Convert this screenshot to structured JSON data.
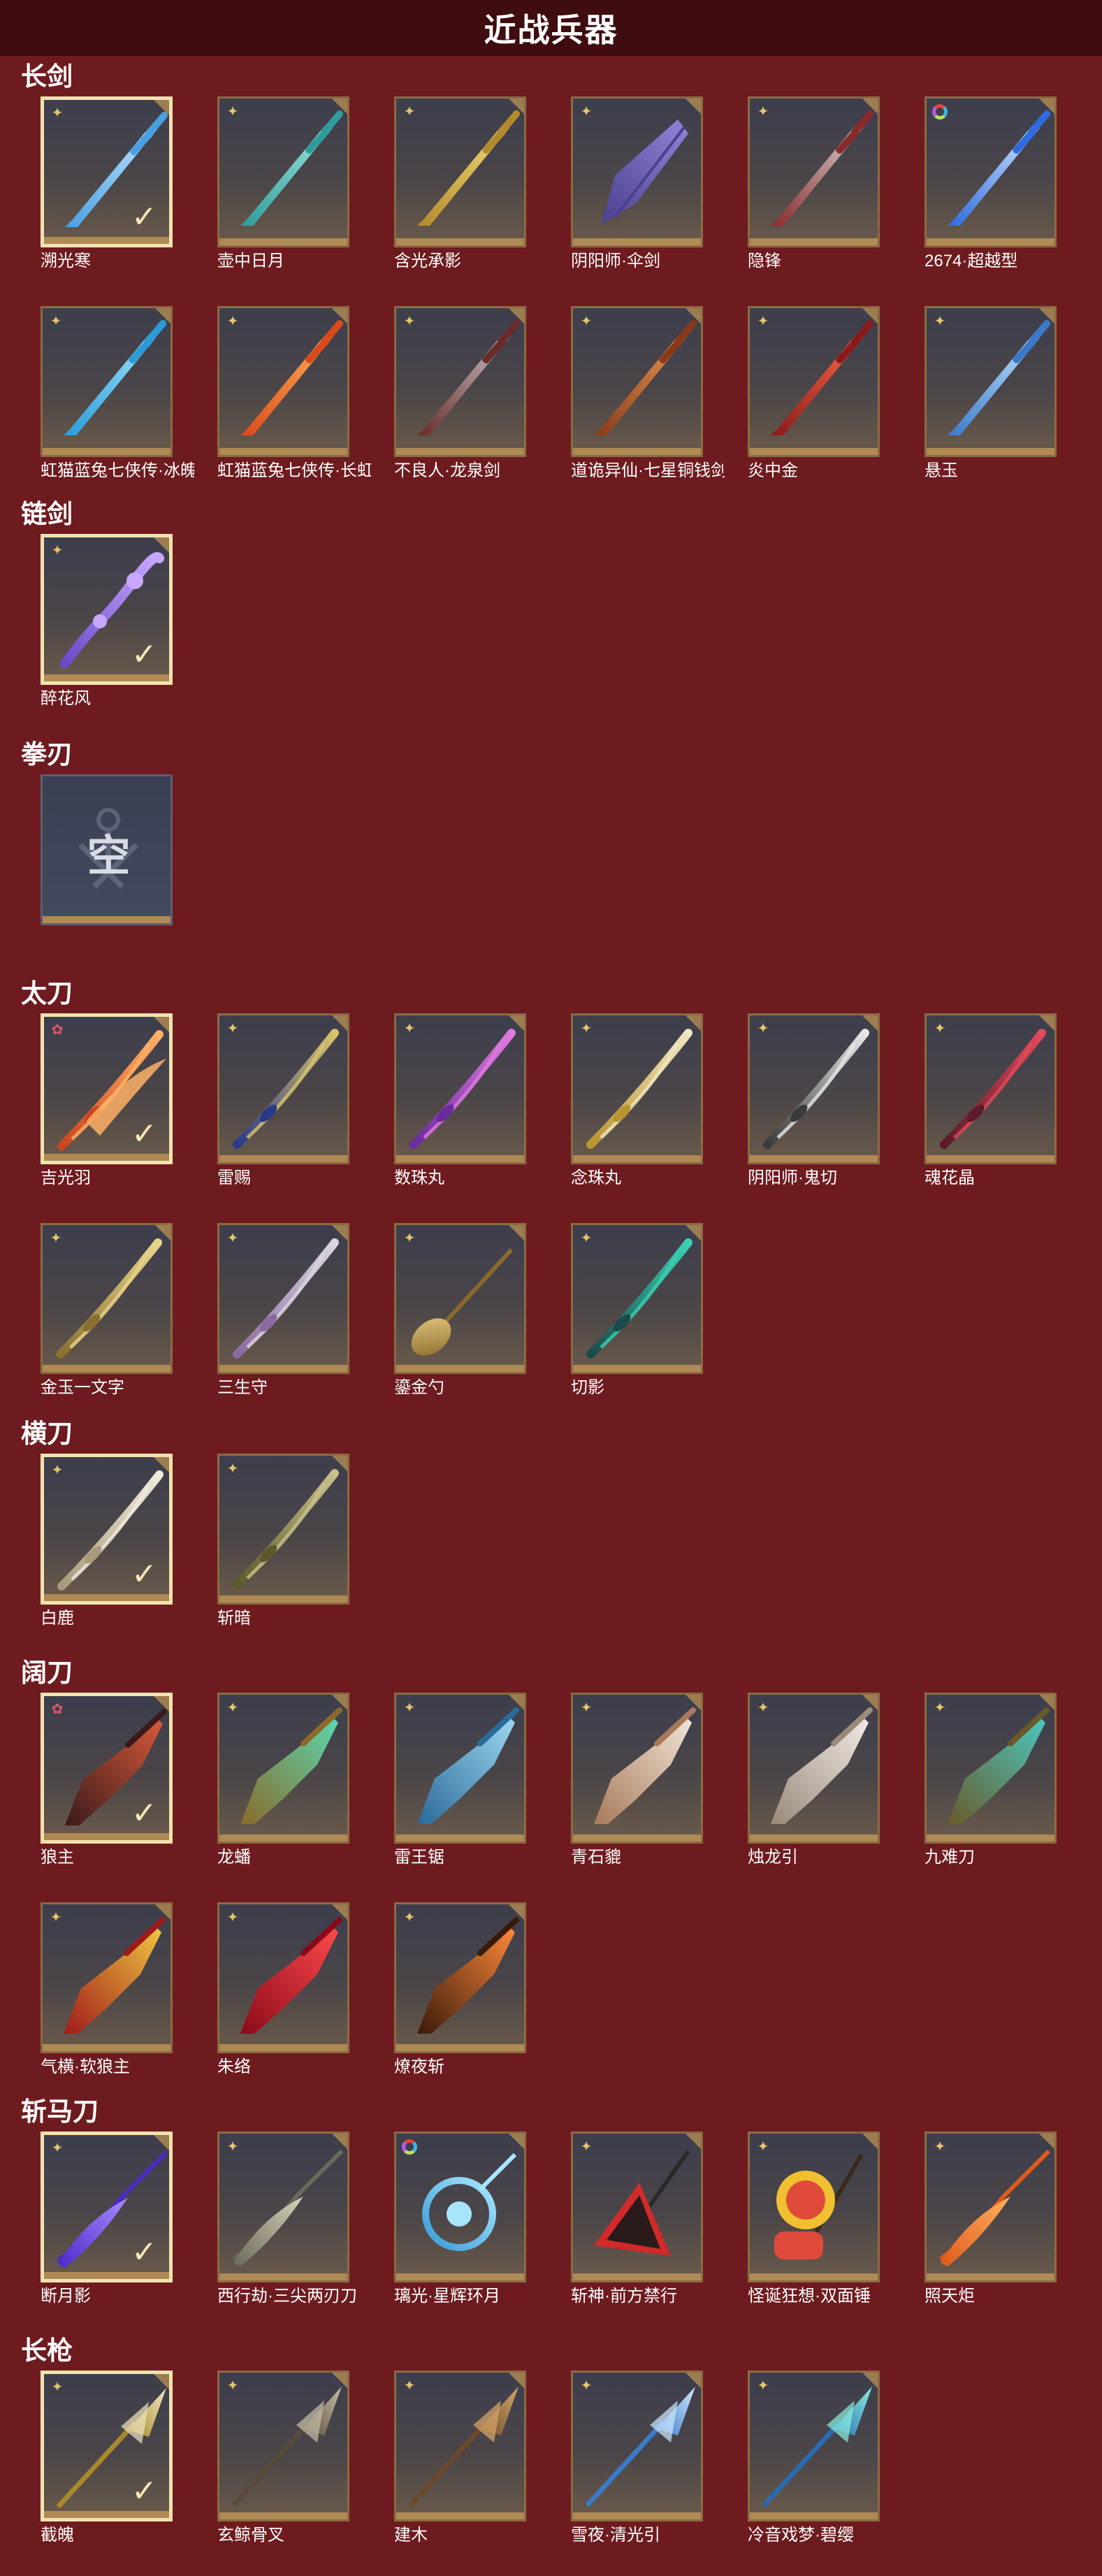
{
  "header": {
    "title": "近战兵器"
  },
  "sections": [
    {
      "label": "长剑",
      "items": [
        {
          "name": "溯光寒",
          "badge": "star4",
          "selected": true,
          "weapon": "sword",
          "c1": "#bfe6ff",
          "c2": "#4a9fe0"
        },
        {
          "name": "壶中日月",
          "badge": "star4",
          "weapon": "sword",
          "c1": "#9fe8e0",
          "c2": "#2f9b9b"
        },
        {
          "name": "含光承影",
          "badge": "star4",
          "weapon": "sword",
          "c1": "#f2df7a",
          "c2": "#b38a2c"
        },
        {
          "name": "阴阳师·伞剑",
          "badge": "star4",
          "weapon": "umbrella",
          "c1": "#8f86d8",
          "c2": "#4b3f8e"
        },
        {
          "name": "隐锋",
          "badge": "star4",
          "weapon": "sword",
          "c1": "#d7d7d7",
          "c2": "#8a2a2a"
        },
        {
          "name": "2674·超越型",
          "badge": "ring",
          "weapon": "sword",
          "c1": "#d7ecff",
          "c2": "#2f6ae0"
        },
        {
          "name": "虹猫蓝兔七侠传·冰魄...",
          "badge": "star4",
          "weapon": "sword",
          "c1": "#9fe6ff",
          "c2": "#2b9bd8"
        },
        {
          "name": "虹猫蓝兔七侠传·长虹...",
          "badge": "star4",
          "weapon": "sword",
          "c1": "#ffb25a",
          "c2": "#d94a1a"
        },
        {
          "name": "不良人·龙泉剑",
          "badge": "star4",
          "weapon": "sword",
          "c1": "#c9c9c9",
          "c2": "#6a2a2a"
        },
        {
          "name": "道诡异仙·七星铜钱剑",
          "badge": "star4",
          "weapon": "sword",
          "c1": "#e89a55",
          "c2": "#8a3a1a"
        },
        {
          "name": "炎中金",
          "badge": "star4",
          "weapon": "sword",
          "c1": "#ff6a4a",
          "c2": "#8a1a1a"
        },
        {
          "name": "悬玉",
          "badge": "star4",
          "weapon": "sword",
          "c1": "#c7e4ff",
          "c2": "#3a7ac8"
        }
      ]
    },
    {
      "label": "链剑",
      "items": [
        {
          "name": "醉花风",
          "badge": "star4",
          "selected": true,
          "weapon": "chain",
          "c1": "#c8a8ff",
          "c2": "#6a4ac8"
        }
      ]
    },
    {
      "label": "拳刃",
      "items": [
        {
          "name": "",
          "badge": "none",
          "empty": true,
          "empty_text": "空"
        }
      ]
    },
    {
      "label": "太刀",
      "items": [
        {
          "name": "吉光羽",
          "badge": "star6",
          "selected": true,
          "weapon": "wing",
          "c1": "#ffb067",
          "c2": "#c8461e"
        },
        {
          "name": "雷赐",
          "badge": "star4",
          "weapon": "katana",
          "c1": "#d8c36a",
          "c2": "#2a3a8a"
        },
        {
          "name": "数珠丸",
          "badge": "star4",
          "weapon": "katana",
          "c1": "#e07adf",
          "c2": "#6a2aa0"
        },
        {
          "name": "念珠丸",
          "badge": "star4",
          "weapon": "katana",
          "c1": "#f0e6c0",
          "c2": "#b8942e"
        },
        {
          "name": "阴阳师·鬼切",
          "badge": "star4",
          "weapon": "katana",
          "c1": "#e6e6e6",
          "c2": "#3a3a3a"
        },
        {
          "name": "魂花晶",
          "badge": "star4",
          "weapon": "katana",
          "c1": "#e04a5a",
          "c2": "#5a1a2a"
        },
        {
          "name": "金玉一文字",
          "badge": "star4",
          "weapon": "katana",
          "c1": "#e8d58a",
          "c2": "#8a7030"
        },
        {
          "name": "三生守",
          "badge": "star4",
          "weapon": "katana",
          "c1": "#dcd6e0",
          "c2": "#8a6aa0"
        },
        {
          "name": "鎏金勺",
          "badge": "star4",
          "weapon": "spoon",
          "c1": "#e6c880",
          "c2": "#8a6a2a"
        },
        {
          "name": "切影",
          "badge": "star4",
          "weapon": "katana",
          "c1": "#3ad0b0",
          "c2": "#1a4a4a"
        }
      ]
    },
    {
      "label": "横刀",
      "items": [
        {
          "name": "白鹿",
          "badge": "star4",
          "selected": true,
          "weapon": "katana",
          "c1": "#f0eadc",
          "c2": "#a89a7a"
        },
        {
          "name": "斩暗",
          "badge": "star4",
          "weapon": "katana",
          "c1": "#c8c08a",
          "c2": "#5a5a2a"
        }
      ]
    },
    {
      "label": "阔刀",
      "items": [
        {
          "name": "狼主",
          "badge": "star6",
          "selected": true,
          "weapon": "broad",
          "c1": "#d85a3a",
          "c2": "#3a1a1a"
        },
        {
          "name": "龙蟠",
          "badge": "star4",
          "weapon": "broad",
          "c1": "#5ad8b0",
          "c2": "#8a6a2a"
        },
        {
          "name": "雷王锯",
          "badge": "star4",
          "weapon": "broad",
          "c1": "#9fd8f0",
          "c2": "#2a6a9a"
        },
        {
          "name": "青石貔",
          "badge": "star4",
          "weapon": "broad",
          "c1": "#f0e6d8",
          "c2": "#a87a5a"
        },
        {
          "name": "烛龙引",
          "badge": "star4",
          "weapon": "broad",
          "c1": "#f0ece6",
          "c2": "#9a8a7a"
        },
        {
          "name": "九难刀",
          "badge": "star4",
          "weapon": "broad",
          "c1": "#4ac8c0",
          "c2": "#6a5a2a"
        },
        {
          "name": "气横·软狼主",
          "badge": "star4",
          "weapon": "broad",
          "c1": "#f0c840",
          "c2": "#a01a1a"
        },
        {
          "name": "朱络",
          "badge": "star4",
          "weapon": "broad",
          "c1": "#ff4a4a",
          "c2": "#8a0a1a"
        },
        {
          "name": "燎夜斩",
          "badge": "star4",
          "weapon": "broad",
          "c1": "#ff8a3a",
          "c2": "#3a1a0a"
        }
      ]
    },
    {
      "label": "斩马刀",
      "items": [
        {
          "name": "断月影",
          "badge": "star4",
          "selected": true,
          "weapon": "glaive",
          "c1": "#a88aff",
          "c2": "#4a2ac8"
        },
        {
          "name": "西行劫·三尖两刃刀",
          "badge": "star4",
          "weapon": "glaive",
          "c1": "#d8d0b8",
          "c2": "#6a6a5a"
        },
        {
          "name": "璃光·星辉环月",
          "badge": "ring",
          "weapon": "ringblade",
          "c1": "#a8e6ff",
          "c2": "#3a9ad8"
        },
        {
          "name": "斩神·前方禁行",
          "badge": "star4",
          "weapon": "sign",
          "c1": "#d02a2a",
          "c2": "#2a1a1a"
        },
        {
          "name": "怪诞狂想·双面锤",
          "badge": "star4",
          "weapon": "hammer",
          "c1": "#e04a3a",
          "c2": "#f0c030"
        },
        {
          "name": "照天炬",
          "badge": "star4",
          "weapon": "glaive",
          "c1": "#ffb060",
          "c2": "#e05a1a"
        }
      ]
    },
    {
      "label": "长枪",
      "items": [
        {
          "name": "截魄",
          "badge": "star4",
          "selected": true,
          "weapon": "spear",
          "c1": "#f0e6c0",
          "c2": "#a8882a"
        },
        {
          "name": "玄鲸骨叉",
          "badge": "star4",
          "weapon": "spear",
          "c1": "#c8c0a8",
          "c2": "#5a4a3a"
        },
        {
          "name": "建木",
          "badge": "star4",
          "weapon": "spear",
          "c1": "#d8a86a",
          "c2": "#6a4a2a"
        },
        {
          "name": "雪夜·清光引",
          "badge": "star4",
          "weapon": "spear",
          "c1": "#cfeaff",
          "c2": "#3a7ac8"
        },
        {
          "name": "冷音戏梦·碧缨",
          "badge": "star4",
          "weapon": "spear",
          "c1": "#8af0e0",
          "c2": "#2a6ab0"
        }
      ]
    }
  ],
  "icons": {
    "star4": "four-point-star-icon",
    "star6": "six-point-star-icon",
    "ring": "rainbow-ring-icon",
    "check": "check-icon"
  },
  "colors": {
    "background": "#6e1b1f",
    "header": "#3f0c10",
    "card_border": "#8b6b43",
    "selected_border": "#f3e3b0"
  }
}
